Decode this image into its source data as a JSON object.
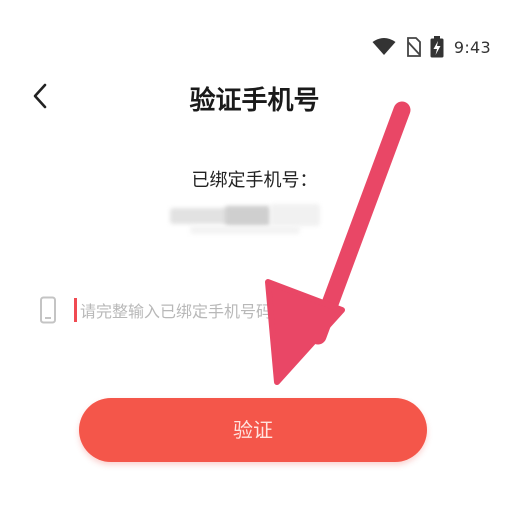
{
  "status_bar": {
    "time": "9:43",
    "icons": [
      "wifi-icon",
      "no-sim-icon",
      "battery-charging-icon"
    ]
  },
  "header": {
    "back_icon": "chevron-left-icon",
    "title": "验证手机号"
  },
  "bound_phone": {
    "label": "已绑定手机号："
  },
  "phone_input": {
    "icon": "phone-icon",
    "placeholder": "请完整输入已绑定手机号码",
    "value": ""
  },
  "verify_button": {
    "label": "验证"
  },
  "colors": {
    "accent": "#f4564a",
    "arrow": "#e94766",
    "cursor": "#f04a52"
  }
}
